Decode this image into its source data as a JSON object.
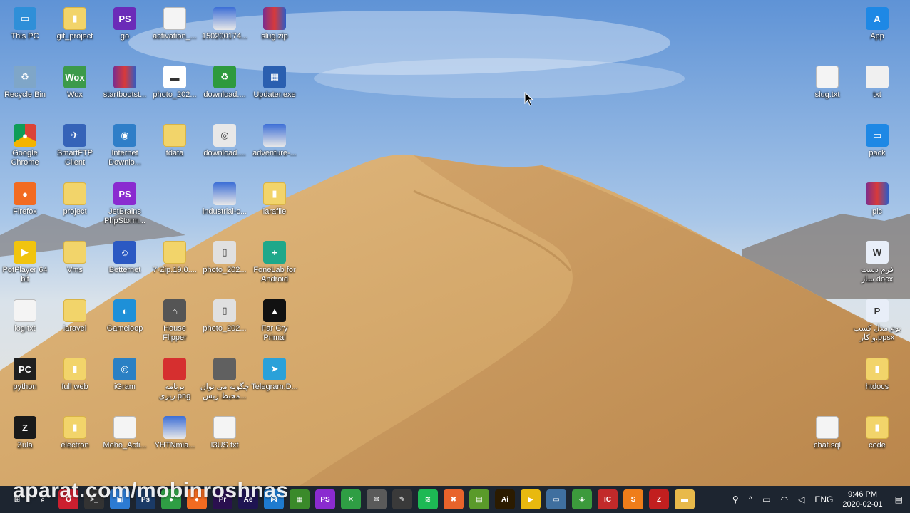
{
  "desktop": {
    "icons": [
      {
        "id": "this-pc",
        "label": "This PC",
        "glyph": "▭",
        "style": "#2f8fd8"
      },
      {
        "id": "git-project",
        "label": "git_project",
        "glyph": "▮",
        "style": "folder"
      },
      {
        "id": "go",
        "label": "go",
        "glyph": "PS",
        "style": "#6b2bb8"
      },
      {
        "id": "activation",
        "label": "activation_...",
        "glyph": "",
        "style": "doc"
      },
      {
        "id": "img-150200174",
        "label": "150200174...",
        "glyph": "",
        "style": "img"
      },
      {
        "id": "slug-zip",
        "label": "slug.zip",
        "glyph": "",
        "style": "rar"
      },
      {
        "id": "recycle-bin",
        "label": "Recycle Bin",
        "glyph": "♻",
        "style": "#7fa6c8"
      },
      {
        "id": "wox",
        "label": "Wox",
        "glyph": "Wox",
        "style": "#3c9a4a"
      },
      {
        "id": "startbootstrap",
        "label": "startbootst...",
        "glyph": "",
        "style": "rar"
      },
      {
        "id": "photo-202-a",
        "label": "photo_202...",
        "glyph": "▬",
        "style": "#ffffff"
      },
      {
        "id": "download-a",
        "label": "download....",
        "glyph": "♻",
        "style": "#2e9a3e"
      },
      {
        "id": "updater",
        "label": "Updater.exe",
        "glyph": "▦",
        "style": "#2a5fb0"
      },
      {
        "id": "chrome",
        "label": "Google\nChrome",
        "glyph": "●",
        "style": "chrome"
      },
      {
        "id": "smartftp",
        "label": "SmartFTP\nClient",
        "glyph": "✈",
        "style": "#3563b8"
      },
      {
        "id": "idm",
        "label": "Internet\nDownlo...",
        "glyph": "◉",
        "style": "#2f7ec8"
      },
      {
        "id": "tdata",
        "label": "tdata",
        "glyph": "",
        "style": "folder"
      },
      {
        "id": "download-b",
        "label": "download....",
        "glyph": "◎",
        "style": "#e8e8e8"
      },
      {
        "id": "adventure",
        "label": "adventure-...",
        "glyph": "",
        "style": "img"
      },
      {
        "id": "firefox",
        "label": "Firefox",
        "glyph": "●",
        "style": "#f26b21"
      },
      {
        "id": "project",
        "label": "project",
        "glyph": "",
        "style": "folder"
      },
      {
        "id": "phpstorm",
        "label": "JetBrains\nPhpStorm...",
        "glyph": "PS",
        "style": "#8a2bd0"
      },
      {
        "id": "industrial",
        "label": "industrial-c...",
        "glyph": "",
        "style": "img"
      },
      {
        "id": "larafile",
        "label": "larafile",
        "glyph": "▮",
        "style": "folder"
      },
      {
        "id": "potplayer",
        "label": "PotPlayer 64\nbit",
        "glyph": "▶",
        "style": "#f1c40f"
      },
      {
        "id": "vms",
        "label": "Vms",
        "glyph": "",
        "style": "folder"
      },
      {
        "id": "betternet",
        "label": "Betternet",
        "glyph": "☺",
        "style": "#2b59c3"
      },
      {
        "id": "seven-zip",
        "label": "7-Zip.19.0....",
        "glyph": "",
        "style": "folder"
      },
      {
        "id": "photo-202-b",
        "label": "photo_202...",
        "glyph": "▯",
        "style": "#e0e0e0"
      },
      {
        "id": "fonelab",
        "label": "FoneLab for\nAndroid",
        "glyph": "+",
        "style": "#1fa88a"
      },
      {
        "id": "log-txt",
        "label": "log.txt",
        "glyph": "",
        "style": "doc"
      },
      {
        "id": "laravel",
        "label": "laravel",
        "glyph": "",
        "style": "folder"
      },
      {
        "id": "gameloop",
        "label": "Gameloop",
        "glyph": "◐",
        "style": "#1e90d8"
      },
      {
        "id": "house-flipper",
        "label": "House\nFlipper",
        "glyph": "⌂",
        "style": "#555555"
      },
      {
        "id": "photo-202-c",
        "label": "photo_202...",
        "glyph": "▯",
        "style": "#e0e0e0"
      },
      {
        "id": "far-cry",
        "label": "Far Cry\nPrimal",
        "glyph": "▲",
        "style": "#111111"
      },
      {
        "id": "python",
        "label": "python",
        "glyph": "PC",
        "style": "#1f1f1f"
      },
      {
        "id": "full-web",
        "label": "full web",
        "glyph": "▮",
        "style": "folder"
      },
      {
        "id": "igram",
        "label": "iGram",
        "glyph": "◎",
        "style": "#2a80c4"
      },
      {
        "id": "barname-png",
        "label": "برنامه\nریزی.png",
        "glyph": "",
        "style": "#d62f2f"
      },
      {
        "id": "chegone",
        "label": "چگونه می توان\nمحیط زیس...",
        "glyph": "",
        "style": "#606060"
      },
      {
        "id": "telegram",
        "label": "Telegram.D...",
        "glyph": "➤",
        "style": "#2aa1d9"
      },
      {
        "id": "zula",
        "label": "Zula",
        "glyph": "Z",
        "style": "#1a1a1a"
      },
      {
        "id": "electron",
        "label": "electron",
        "glyph": "▮",
        "style": "folder"
      },
      {
        "id": "moho",
        "label": "Moho_Acti...",
        "glyph": "",
        "style": "doc"
      },
      {
        "id": "yhtnmia",
        "label": "YHTNmia...",
        "glyph": "",
        "style": "img"
      },
      {
        "id": "i3us-txt",
        "label": "I3US.txt",
        "glyph": "",
        "style": "doc"
      },
      {
        "id": "app",
        "label": "App",
        "glyph": "A",
        "style": "#1e88e5"
      },
      {
        "id": "slug-txt",
        "label": "slug.txt",
        "glyph": "",
        "style": "doc"
      },
      {
        "id": "txt",
        "label": "txt",
        "glyph": "",
        "style": "#f0f0f0"
      },
      {
        "id": "pack",
        "label": "pack",
        "glyph": "▭",
        "style": "#1e88e5"
      },
      {
        "id": "pic",
        "label": "pic",
        "glyph": "",
        "style": "rar"
      },
      {
        "id": "form-dast-saz",
        "label": "فرم دست\nساز.docx",
        "glyph": "W",
        "style": "#e8eef8"
      },
      {
        "id": "boom-model",
        "label": "بوم مدل کسب\nو کار.ppsx",
        "glyph": "P",
        "style": "#e8eef8"
      },
      {
        "id": "htdocs",
        "label": "htdocs",
        "glyph": "▮",
        "style": "folder"
      },
      {
        "id": "chat-sql",
        "label": "chat.sql",
        "glyph": "",
        "style": "doc"
      },
      {
        "id": "code",
        "label": "code",
        "glyph": "▮",
        "style": "folder"
      }
    ]
  },
  "watermark": {
    "text": "aparat.com/mobinroshnas"
  },
  "taskbar": {
    "apps": [
      {
        "id": "start",
        "glyph": "⊞",
        "color": "#1d2530"
      },
      {
        "id": "search",
        "glyph": "⌕",
        "color": "#1d2530"
      },
      {
        "id": "opera",
        "glyph": "O",
        "color": "#cc1f2f"
      },
      {
        "id": "terminal",
        "glyph": ">_",
        "color": "#333333"
      },
      {
        "id": "vs",
        "glyph": "▣",
        "color": "#2c7bd3"
      },
      {
        "id": "ps",
        "glyph": "Ps",
        "color": "#1a3a66"
      },
      {
        "id": "chrome",
        "glyph": "●",
        "color": "#2f9e44"
      },
      {
        "id": "firefox",
        "glyph": "●",
        "color": "#f26b21"
      },
      {
        "id": "premiere",
        "glyph": "Pr",
        "color": "#2a0f4f"
      },
      {
        "id": "aftereffects",
        "glyph": "Ae",
        "color": "#1f1452"
      },
      {
        "id": "vscode",
        "glyph": "⋈",
        "color": "#1e7bd0"
      },
      {
        "id": "android-tool",
        "glyph": "▦",
        "color": "#3a8a2a"
      },
      {
        "id": "phpstorm",
        "glyph": "PS",
        "color": "#8a2bd0"
      },
      {
        "id": "xbox",
        "glyph": "✕",
        "color": "#2f9e44"
      },
      {
        "id": "mail",
        "glyph": "✉",
        "color": "#5a5a5a"
      },
      {
        "id": "pen",
        "glyph": "✎",
        "color": "#3a3a3a"
      },
      {
        "id": "spotify",
        "glyph": "≋",
        "color": "#1db954"
      },
      {
        "id": "xampp",
        "glyph": "✖",
        "color": "#e8632b"
      },
      {
        "id": "notepad",
        "glyph": "▤",
        "color": "#5a9a2a"
      },
      {
        "id": "illustrator",
        "glyph": "Ai",
        "color": "#2b1b00"
      },
      {
        "id": "potplayer",
        "glyph": "▶",
        "color": "#e8b90f"
      },
      {
        "id": "explorer2",
        "glyph": "▭",
        "color": "#3f6f9f"
      },
      {
        "id": "android",
        "glyph": "◈",
        "color": "#3c9a3c"
      },
      {
        "id": "jetbrains",
        "glyph": "IC",
        "color": "#c22a2a"
      },
      {
        "id": "sublime",
        "glyph": "S",
        "color": "#ef7d1a"
      },
      {
        "id": "filezilla",
        "glyph": "Z",
        "color": "#c21f1f"
      },
      {
        "id": "folder",
        "glyph": "▬",
        "color": "#e8b94a"
      }
    ],
    "tray": {
      "people_icon": "person-icon",
      "chevron": "^",
      "lang": "ENG",
      "time": "9:46 PM",
      "date": "2020-02-01"
    }
  }
}
